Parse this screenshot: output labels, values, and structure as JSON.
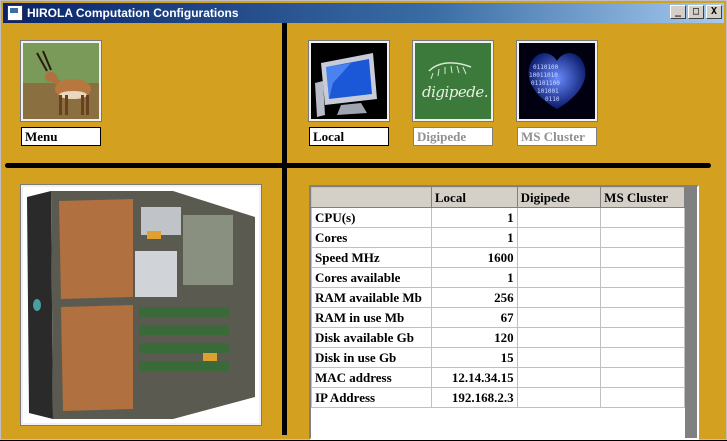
{
  "window": {
    "title": "HIROLA Computation Configurations",
    "controls": {
      "minimize": "_",
      "maximize": "□",
      "close": "X"
    }
  },
  "nav": {
    "menu_label": "Menu",
    "local_label": "Local",
    "digipede_label": "Digipede",
    "digipede_logo_text": "digipede.",
    "mscluster_label": "MS Cluster"
  },
  "grid": {
    "headers": [
      "",
      "Local",
      "Digipede",
      "MS Cluster"
    ],
    "rows": [
      {
        "label": "CPU(s)",
        "local": "1",
        "digipede": "",
        "mscluster": ""
      },
      {
        "label": "Cores",
        "local": "1",
        "digipede": "",
        "mscluster": ""
      },
      {
        "label": "Speed MHz",
        "local": "1600",
        "digipede": "",
        "mscluster": ""
      },
      {
        "label": "Cores available",
        "local": "1",
        "digipede": "",
        "mscluster": ""
      },
      {
        "label": "RAM available Mb",
        "local": "256",
        "digipede": "",
        "mscluster": ""
      },
      {
        "label": "RAM in use Mb",
        "local": "67",
        "digipede": "",
        "mscluster": ""
      },
      {
        "label": "Disk available Gb",
        "local": "120",
        "digipede": "",
        "mscluster": ""
      },
      {
        "label": "Disk in use Gb",
        "local": "15",
        "digipede": "",
        "mscluster": ""
      },
      {
        "label": "MAC address",
        "local": "12.14.34.15",
        "digipede": "",
        "mscluster": ""
      },
      {
        "label": "IP Address",
        "local": "192.168.2.3",
        "digipede": "",
        "mscluster": ""
      }
    ]
  },
  "colors": {
    "background": "#d4a020",
    "divider": "#000000",
    "title_start": "#0a246a",
    "title_end": "#a6caf0"
  },
  "icons": {
    "menu": "antelope-photo-icon",
    "local": "computer-monitor-icon",
    "digipede": "digipede-logo-icon",
    "mscluster": "binary-globe-icon"
  }
}
